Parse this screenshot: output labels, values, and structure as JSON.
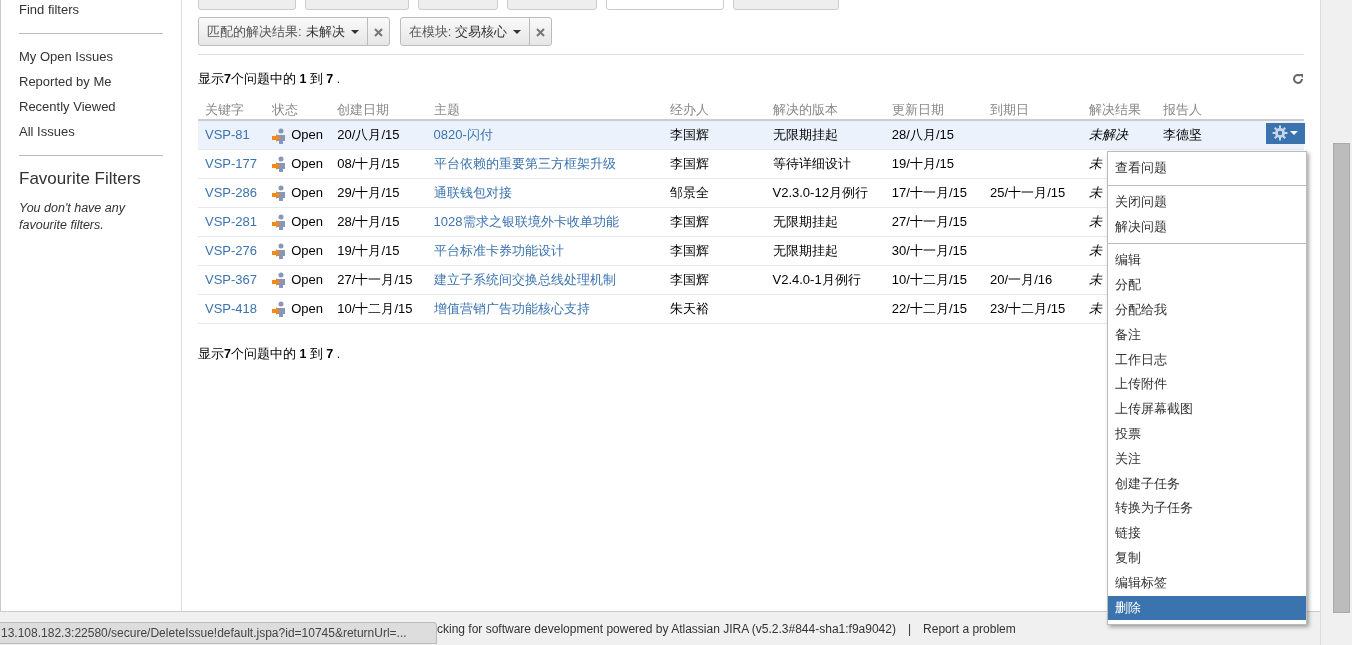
{
  "sidebar": {
    "find_filters": "Find filters",
    "links": [
      "My Open Issues",
      "Reported by Me",
      "Recently Viewed",
      "All Issues"
    ],
    "favourites_title": "Favourite Filters",
    "favourites_empty": "You don't have any favourite filters."
  },
  "filters": [
    {
      "label": "匹配的解决结果:",
      "value": "未解决"
    },
    {
      "label": "在模块:",
      "value": "交易核心"
    }
  ],
  "summary_top": "显示**7**个问题中的 **1** 到 **7** .",
  "table": {
    "columns": [
      "关键字",
      "状态",
      "创建日期",
      "主题",
      "经办人",
      "解决的版本",
      "更新日期",
      "到期日",
      "解决结果",
      "报告人"
    ],
    "rows": [
      {
        "key": "VSP-81",
        "status": "Open",
        "created": "20/八月/15",
        "summary": "0820-闪付",
        "assignee": "李国辉",
        "fix_version": "无限期挂起",
        "updated": "28/八月/15",
        "resolution": "未解决",
        "reporter": "李德坚",
        "selected": true
      },
      {
        "key": "VSP-177",
        "status": "Open",
        "created": "08/十月/15",
        "summary": "平台依赖的重要第三方框架升级",
        "assignee": "李国辉",
        "fix_version": "等待详细设计",
        "updated": "19/十月/15",
        "resolution": "未",
        "selected": false
      },
      {
        "key": "VSP-286",
        "status": "Open",
        "created": "29/十月/15",
        "summary": "通联钱包对接",
        "assignee": "邹景全",
        "fix_version": "V2.3.0-12月例行",
        "updated": "17/十一月/15",
        "due": "25/十一月/15",
        "resolution": "未",
        "selected": false
      },
      {
        "key": "VSP-281",
        "status": "Open",
        "created": "28/十月/15",
        "summary": "1028需求之银联境外卡收单功能",
        "assignee": "李国辉",
        "fix_version": "无限期挂起",
        "updated": "27/十一月/15",
        "resolution": "未",
        "selected": false
      },
      {
        "key": "VSP-276",
        "status": "Open",
        "created": "19/十月/15",
        "summary": "平台标准卡券功能设计",
        "assignee": "李国辉",
        "fix_version": "无限期挂起",
        "updated": "30/十一月/15",
        "resolution": "未",
        "selected": false
      },
      {
        "key": "VSP-367",
        "status": "Open",
        "created": "27/十一月/15",
        "summary": "建立子系统间交换总线处理机制",
        "assignee": "李国辉",
        "fix_version": "V2.4.0-1月例行",
        "updated": "10/十二月/15",
        "due": "20/一月/16",
        "resolution": "未",
        "selected": false
      },
      {
        "key": "VSP-418",
        "status": "Open",
        "created": "10/十二月/15",
        "summary": "增值营销广告功能核心支持",
        "assignee": "朱天裕",
        "updated": "22/十二月/15",
        "due": "23/十二月/15",
        "resolution": "未",
        "selected": false
      }
    ]
  },
  "action_menu": {
    "sections": [
      [
        {
          "label": "查看问题",
          "selected": false
        }
      ],
      [
        {
          "label": "关闭问题",
          "selected": false
        },
        {
          "label": "解决问题",
          "selected": false
        }
      ],
      [
        {
          "label": "编辑",
          "selected": false
        },
        {
          "label": "分配",
          "selected": false
        },
        {
          "label": "分配给我",
          "selected": false
        },
        {
          "label": "备注",
          "selected": false
        },
        {
          "label": "工作日志",
          "selected": false
        },
        {
          "label": "上传附件",
          "selected": false
        },
        {
          "label": "上传屏幕截图",
          "selected": false
        },
        {
          "label": "投票",
          "selected": false
        },
        {
          "label": "关注",
          "selected": false
        },
        {
          "label": "创建子任务",
          "selected": false
        },
        {
          "label": "转换为子任务",
          "selected": false
        },
        {
          "label": "链接",
          "selected": false
        },
        {
          "label": "复制",
          "selected": false
        },
        {
          "label": "编辑标签",
          "selected": false
        },
        {
          "label": "删除",
          "selected": true
        }
      ]
    ]
  },
  "summary_bottom": "显示**7**个问题中的 **1** 到 **7** .",
  "status_url": "13.108.182.3:22580/secure/DeleteIssue!default.jspa?id=10745&returnUrl=...",
  "footer": {
    "text": "cking for software development powered by Atlassian JIRA (v5.2.3#844-sha1:f9a9042)",
    "separator": "|",
    "link": "Report a problem"
  }
}
